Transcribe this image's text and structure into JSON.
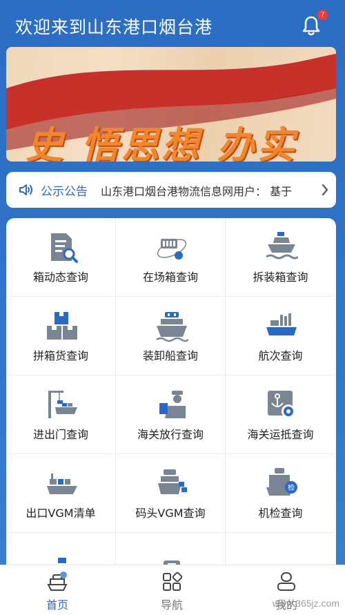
{
  "header": {
    "title": "欢迎来到山东港口烟台港",
    "notification_count": "7"
  },
  "banner": {
    "slogan": "史 悟思想 办实",
    "active_slide": 2,
    "slide_count": 3
  },
  "notice": {
    "title": "公示公告",
    "text": "山东港口烟台港物流信息网用户： 基于"
  },
  "grid": {
    "items": [
      {
        "label": "箱动态查询",
        "icon": "document-search-icon"
      },
      {
        "label": "在场箱查询",
        "icon": "yard-container-icon"
      },
      {
        "label": "拆装箱查询",
        "icon": "ship-unload-icon"
      },
      {
        "label": "拼箱货查询",
        "icon": "boxes-icon"
      },
      {
        "label": "装卸船查询",
        "icon": "cargo-ship-icon"
      },
      {
        "label": "航次查询",
        "icon": "voyage-ship-icon"
      },
      {
        "label": "进出门查询",
        "icon": "crane-gate-icon"
      },
      {
        "label": "海关放行查询",
        "icon": "customs-officer-icon"
      },
      {
        "label": "海关运抵查询",
        "icon": "anchor-gear-icon"
      },
      {
        "label": "出口VGM清单",
        "icon": "container-ship-icon"
      },
      {
        "label": "码头VGM查询",
        "icon": "dock-ship-icon"
      },
      {
        "label": "机检查询",
        "icon": "inspection-ship-icon"
      },
      {
        "label": "",
        "icon": "ship-partial-icon"
      },
      {
        "label": "",
        "icon": "ship-partial-icon"
      },
      {
        "label": "",
        "icon": ""
      }
    ]
  },
  "tabbar": {
    "tabs": [
      {
        "label": "首页",
        "icon": "home-ship-icon",
        "active": true
      },
      {
        "label": "导航",
        "icon": "grid-nav-icon",
        "active": false
      },
      {
        "label": "我的",
        "icon": "user-icon",
        "active": false
      }
    ]
  },
  "watermark": "www.365jz.com",
  "colors": {
    "primary": "#2b6dc2",
    "accent": "#2a6ac6",
    "badge": "#ef3b3b",
    "icon_gray": "#6b7686"
  }
}
